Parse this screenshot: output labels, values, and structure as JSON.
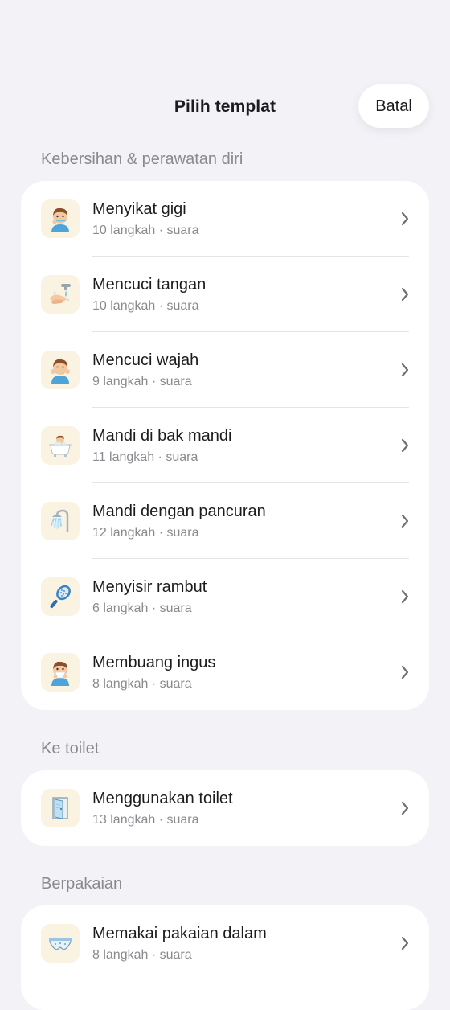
{
  "header": {
    "title": "Pilih templat",
    "cancel_label": "Batal"
  },
  "sections": [
    {
      "title": "Kebersihan & perawatan diri",
      "items": [
        {
          "title": "Menyikat gigi",
          "subtitle": "10 langkah · suara",
          "icon": "child-brushing-teeth-icon"
        },
        {
          "title": "Mencuci tangan",
          "subtitle": "10 langkah · suara",
          "icon": "washing-hands-icon"
        },
        {
          "title": "Mencuci wajah",
          "subtitle": "9 langkah · suara",
          "icon": "child-washing-face-icon"
        },
        {
          "title": "Mandi di bak mandi",
          "subtitle": "11 langkah · suara",
          "icon": "bathtub-icon"
        },
        {
          "title": "Mandi dengan pancuran",
          "subtitle": "12 langkah · suara",
          "icon": "shower-icon"
        },
        {
          "title": "Menyisir rambut",
          "subtitle": "6 langkah · suara",
          "icon": "hairbrush-icon"
        },
        {
          "title": "Membuang ingus",
          "subtitle": "8 langkah · suara",
          "icon": "child-blowing-nose-icon"
        }
      ]
    },
    {
      "title": "Ke toilet",
      "items": [
        {
          "title": "Menggunakan toilet",
          "subtitle": "13 langkah · suara",
          "icon": "toilet-door-icon"
        }
      ]
    },
    {
      "title": "Berpakaian",
      "items": [
        {
          "title": "Memakai pakaian dalam",
          "subtitle": "8 langkah · suara",
          "icon": "underwear-icon"
        }
      ]
    }
  ]
}
